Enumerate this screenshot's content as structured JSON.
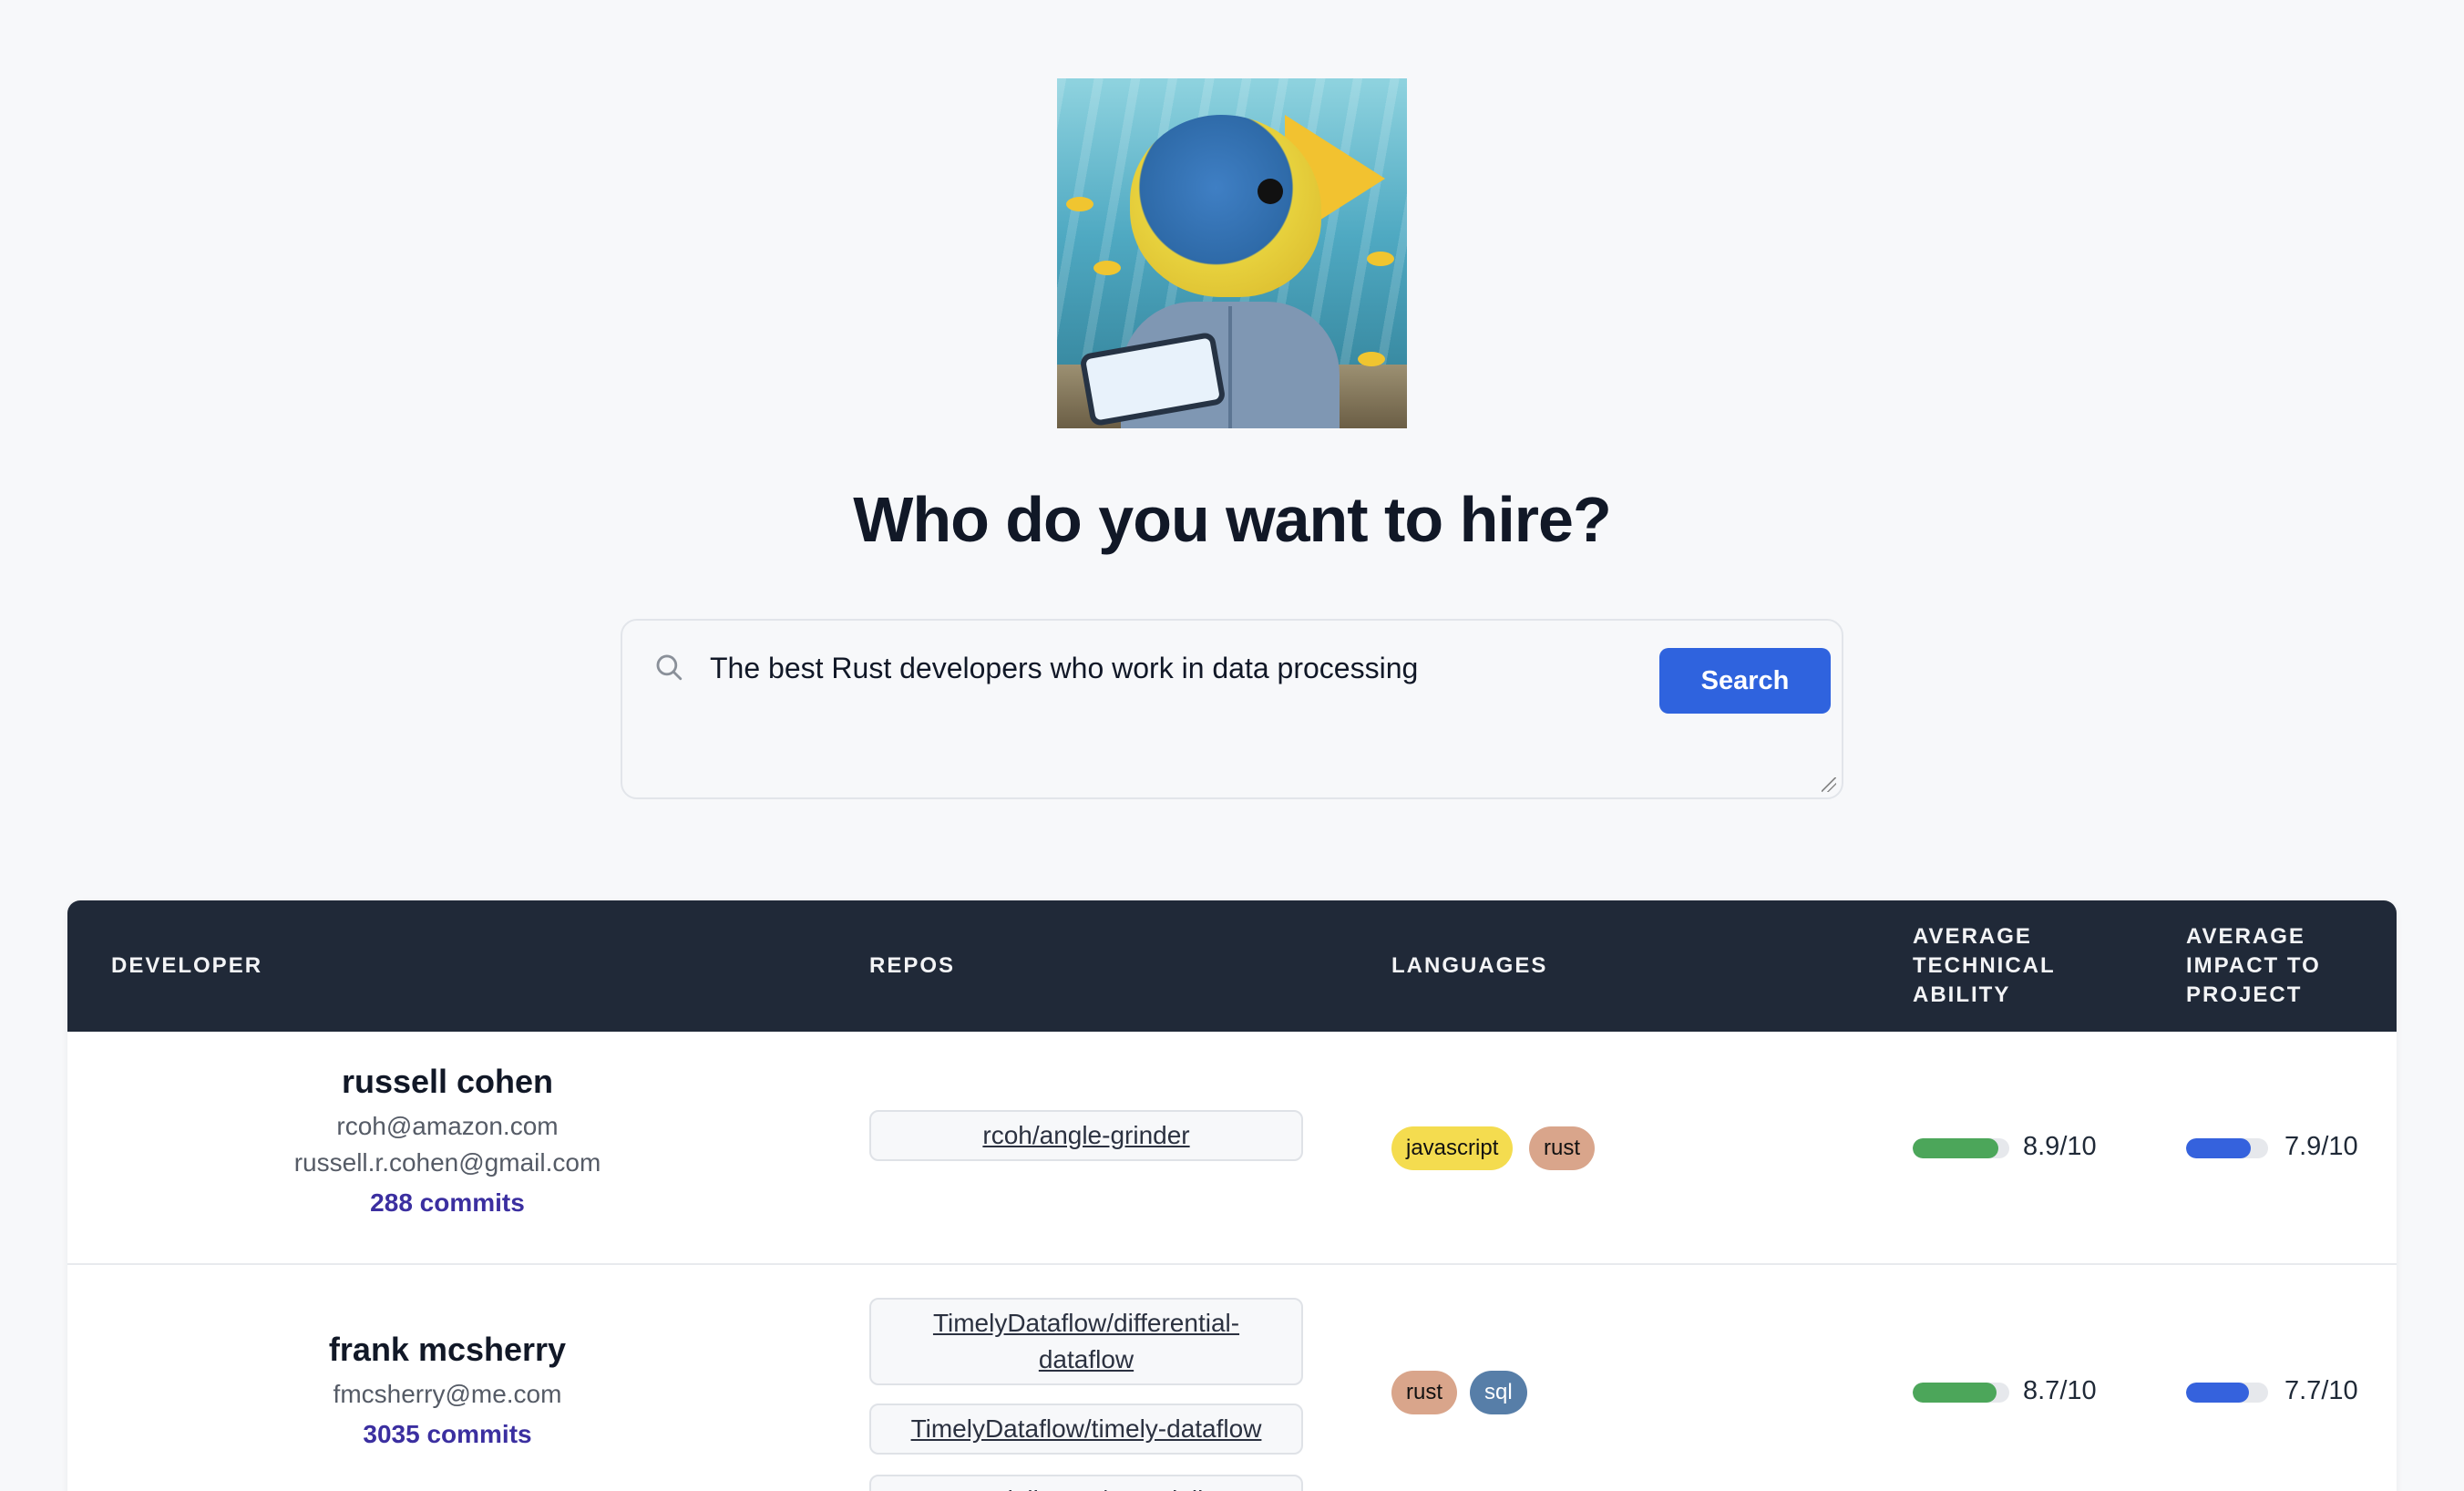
{
  "page": {
    "title": "Who do you want to hire?"
  },
  "search": {
    "query": "The best Rust developers who work in data processing",
    "button_label": "Search"
  },
  "table": {
    "headers": {
      "developer": "DEVELOPER",
      "repos": "REPOS",
      "languages": "LANGUAGES",
      "tech_ability": "AVERAGE\nTECHNICAL\nABILITY",
      "impact": "AVERAGE\nIMPACT TO\nPROJECT"
    },
    "rows": [
      {
        "name": "russell cohen",
        "emails": [
          "rcoh@amazon.com",
          "russell.r.cohen@gmail.com"
        ],
        "commits": "288 commits",
        "repos": [
          "rcoh/angle-grinder"
        ],
        "languages": [
          {
            "name": "javascript",
            "color": "#f4dc4f"
          },
          {
            "name": "rust",
            "color": "#d9a58b"
          }
        ],
        "tech_ability": {
          "score": "8.9/10",
          "value": 0.89,
          "color": "#4ca65a"
        },
        "impact": {
          "score": "7.9/10",
          "value": 0.79,
          "color": "#3562dd"
        }
      },
      {
        "name": "frank mcsherry",
        "emails": [
          "fmcsherry@me.com"
        ],
        "commits": "3035 commits",
        "repos": [
          "TimelyDataflow/differential-dataflow",
          "TimelyDataflow/timely-dataflow",
          "MaterializeInc/materialize"
        ],
        "languages": [
          {
            "name": "rust",
            "color": "#d9a58b"
          },
          {
            "name": "sql",
            "color": "#577ea8"
          }
        ],
        "tech_ability": {
          "score": "8.7/10",
          "value": 0.87,
          "color": "#4ca65a"
        },
        "impact": {
          "score": "7.7/10",
          "value": 0.77,
          "color": "#3562dd"
        }
      }
    ]
  }
}
